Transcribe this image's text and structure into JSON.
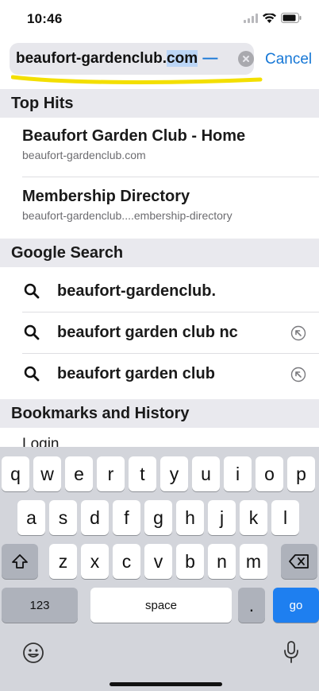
{
  "status_bar": {
    "time": "10:46"
  },
  "search": {
    "url_value": "beaufort-gardenclub.",
    "url_selected": "com",
    "url_dash": " —",
    "cancel_label": "Cancel",
    "highlight_color": "#f3df00"
  },
  "top_hits": {
    "header": "Top Hits",
    "items": [
      {
        "title": "Beaufort Garden Club - Home",
        "url": "beaufort-gardenclub.com"
      },
      {
        "title": "Membership Directory",
        "url": "beaufort-gardenclub....embership-directory"
      }
    ]
  },
  "google_search": {
    "header": "Google Search",
    "items": [
      {
        "text": "beaufort-gardenclub."
      },
      {
        "text": "beaufort garden club nc"
      },
      {
        "text": "beaufort garden club"
      }
    ]
  },
  "bookmarks": {
    "header": "Bookmarks and History",
    "partial_item": "Login"
  },
  "keyboard": {
    "row1": [
      "q",
      "w",
      "e",
      "r",
      "t",
      "y",
      "u",
      "i",
      "o",
      "p"
    ],
    "row2": [
      "a",
      "s",
      "d",
      "f",
      "g",
      "h",
      "j",
      "k",
      "l"
    ],
    "row3": [
      "z",
      "x",
      "c",
      "v",
      "b",
      "n",
      "m"
    ],
    "numbers_label": "123",
    "space_label": "space",
    "period_label": ".",
    "go_label": "go"
  },
  "icons": {
    "signal": "cellular-signal-icon",
    "wifi": "wifi-icon",
    "battery": "battery-icon",
    "clear": "clear-x-icon",
    "search": "magnifier-icon",
    "fill": "arrow-up-left-icon",
    "shift": "shift-icon",
    "delete": "delete-backspace-icon",
    "emoji": "emoji-icon",
    "mic": "microphone-icon"
  },
  "colors": {
    "accent": "#1677d6",
    "go_key": "#1e7ff0",
    "selection": "#bcd6f7"
  }
}
